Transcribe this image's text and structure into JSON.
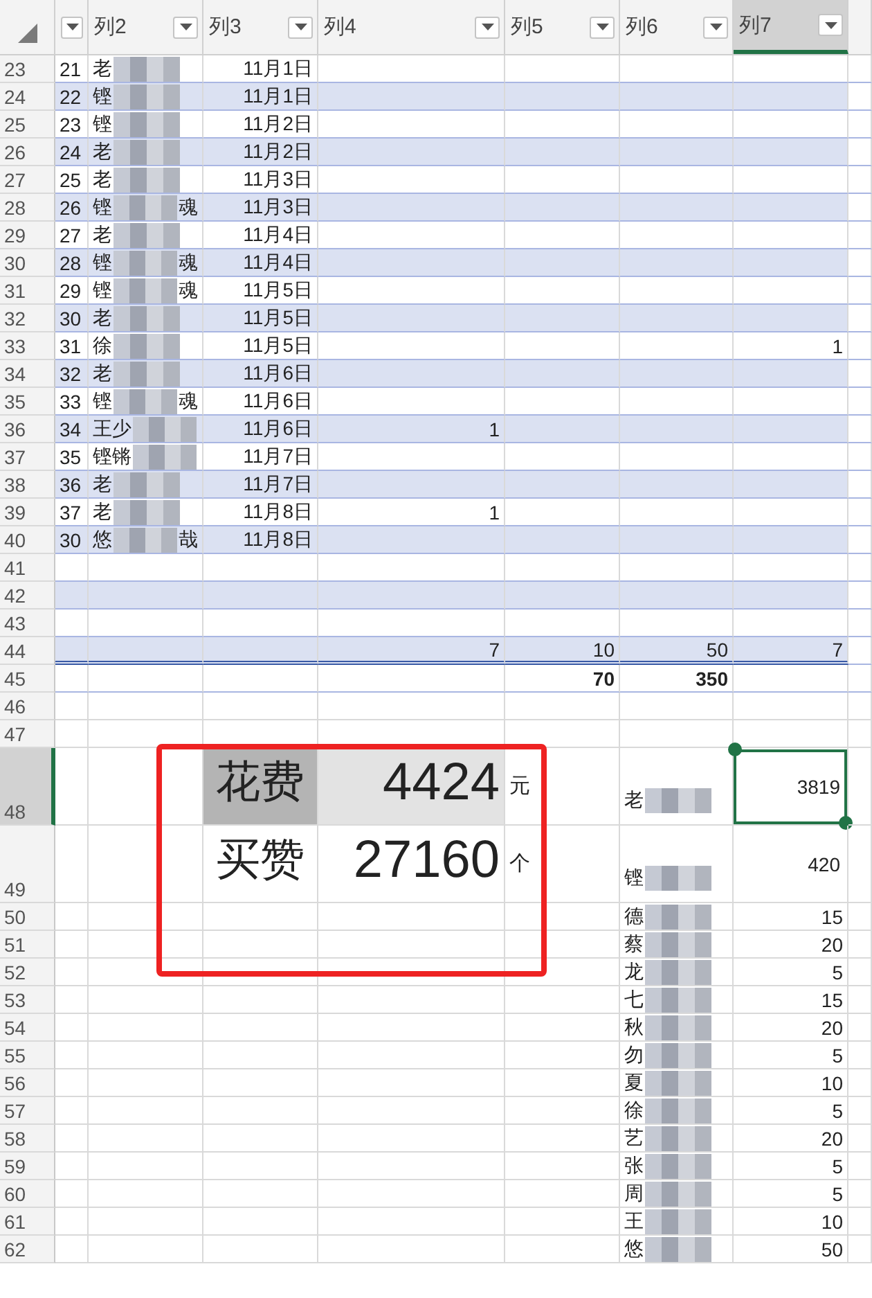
{
  "columns": [
    {
      "selected": false
    },
    {
      "label": "列2",
      "selected": false
    },
    {
      "label": "列3",
      "selected": false
    },
    {
      "label": "列4",
      "selected": false
    },
    {
      "label": "列5",
      "selected": false
    },
    {
      "label": "列6",
      "selected": false
    },
    {
      "label": "列7",
      "selected": true
    }
  ],
  "rows": [
    {
      "number": "23",
      "kind": "plain",
      "selected": false,
      "col_1": "21",
      "col_2": {
        "name": "老"
      },
      "col_3": "11月1日"
    },
    {
      "number": "24",
      "kind": "band",
      "selected": false,
      "col_1": "22",
      "col_2": {
        "name": "铿"
      },
      "col_3": "11月1日"
    },
    {
      "number": "25",
      "kind": "plain",
      "selected": false,
      "col_1": "23",
      "col_2": {
        "name": "铿"
      },
      "col_3": "11月2日"
    },
    {
      "number": "26",
      "kind": "band",
      "selected": false,
      "col_1": "24",
      "col_2": {
        "name": "老"
      },
      "col_3": "11月2日"
    },
    {
      "number": "27",
      "kind": "plain",
      "selected": false,
      "col_1": "25",
      "col_2": {
        "name": "老"
      },
      "col_3": "11月3日"
    },
    {
      "number": "28",
      "kind": "band",
      "selected": false,
      "col_1": "26",
      "col_2": {
        "name": "铿",
        "name_end": "魂"
      },
      "col_3": "11月3日"
    },
    {
      "number": "29",
      "kind": "plain",
      "selected": false,
      "col_1": "27",
      "col_2": {
        "name": "老"
      },
      "col_3": "11月4日"
    },
    {
      "number": "30",
      "kind": "band",
      "selected": false,
      "col_1": "28",
      "col_2": {
        "name": "铿",
        "name_end": "魂"
      },
      "col_3": "11月4日"
    },
    {
      "number": "31",
      "kind": "plain",
      "selected": false,
      "col_1": "29",
      "col_2": {
        "name": "铿",
        "name_end": "魂"
      },
      "col_3": "11月5日"
    },
    {
      "number": "32",
      "kind": "band",
      "selected": false,
      "col_1": "30",
      "col_2": {
        "name": "老"
      },
      "col_3": "11月5日"
    },
    {
      "number": "33",
      "kind": "plain",
      "selected": false,
      "col_1": "31",
      "col_2": {
        "name": "徐"
      },
      "col_3": "11月5日",
      "col_7": "1"
    },
    {
      "number": "34",
      "kind": "band",
      "selected": false,
      "col_1": "32",
      "col_2": {
        "name": "老"
      },
      "col_3": "11月6日"
    },
    {
      "number": "35",
      "kind": "plain",
      "selected": false,
      "col_1": "33",
      "col_2": {
        "name": "铿",
        "name_end": "魂"
      },
      "col_3": "11月6日"
    },
    {
      "number": "36",
      "kind": "band",
      "selected": false,
      "col_1": "34",
      "col_2": {
        "name": "王少"
      },
      "col_3": "11月6日",
      "col_4": "1"
    },
    {
      "number": "37",
      "kind": "plain",
      "selected": false,
      "col_1": "35",
      "col_2": {
        "name": "铿锵"
      },
      "col_3": "11月7日"
    },
    {
      "number": "38",
      "kind": "band",
      "selected": false,
      "col_1": "36",
      "col_2": {
        "name": "老"
      },
      "col_3": "11月7日"
    },
    {
      "number": "39",
      "kind": "plain",
      "selected": false,
      "col_1": "37",
      "col_2": {
        "name": "老"
      },
      "col_3": "11月8日",
      "col_4": "1"
    },
    {
      "number": "40",
      "kind": "band",
      "selected": false,
      "col_1": "30",
      "col_2": {
        "name": "悠",
        "name_end": "哉"
      },
      "col_3": "11月8日"
    },
    {
      "number": "41",
      "kind": "plain",
      "selected": false
    },
    {
      "number": "42",
      "kind": "band",
      "selected": false
    },
    {
      "number": "43",
      "kind": "plain",
      "selected": false
    },
    {
      "number": "44",
      "kind": "total",
      "selected": false,
      "col_4": "7",
      "col_5": "10",
      "col_6": "50",
      "col_7": "7"
    },
    {
      "number": "45",
      "kind": "grand",
      "selected": false,
      "col_5": "70",
      "col_6": "350"
    },
    {
      "number": "46",
      "kind": "grid",
      "selected": false
    },
    {
      "number": "47",
      "kind": "grid",
      "selected": false
    },
    {
      "number": "48",
      "kind": "tall",
      "selected": true,
      "col_3": "花费",
      "label_shaded": true,
      "col_4": "4424",
      "amount_shaded": true,
      "col_5": "元",
      "col_6": {
        "name": "老"
      },
      "col_7": "3819",
      "col_7_selected": true
    },
    {
      "number": "49",
      "kind": "tall",
      "selected": false,
      "col_3": "买赞",
      "label_shaded": false,
      "col_4": "27160",
      "amount_shaded": false,
      "col_5": "个",
      "col_6": {
        "name": "铿"
      },
      "col_7": "420",
      "col_7_selected": false
    },
    {
      "number": "50",
      "kind": "grid",
      "selected": false,
      "col_6": {
        "name": "德"
      },
      "col_7": "15"
    },
    {
      "number": "51",
      "kind": "grid",
      "selected": false,
      "col_6": {
        "name": "蔡"
      },
      "col_7": "20"
    },
    {
      "number": "52",
      "kind": "grid",
      "selected": false,
      "col_6": {
        "name": "龙"
      },
      "col_7": "5"
    },
    {
      "number": "53",
      "kind": "grid",
      "selected": false,
      "col_6": {
        "name": "七"
      },
      "col_7": "15"
    },
    {
      "number": "54",
      "kind": "grid",
      "selected": false,
      "col_6": {
        "name": "秋"
      },
      "col_7": "20"
    },
    {
      "number": "55",
      "kind": "grid",
      "selected": false,
      "col_6": {
        "name": "勿"
      },
      "col_7": "5"
    },
    {
      "number": "56",
      "kind": "grid",
      "selected": false,
      "col_6": {
        "name": "夏"
      },
      "col_7": "10"
    },
    {
      "number": "57",
      "kind": "grid",
      "selected": false,
      "col_6": {
        "name": "徐"
      },
      "col_7": "5"
    },
    {
      "number": "58",
      "kind": "grid",
      "selected": false,
      "col_6": {
        "name": "艺"
      },
      "col_7": "20"
    },
    {
      "number": "59",
      "kind": "grid",
      "selected": false,
      "col_6": {
        "name": "张"
      },
      "col_7": "5"
    },
    {
      "number": "60",
      "kind": "grid",
      "selected": false,
      "col_6": {
        "name": "周"
      },
      "col_7": "5"
    },
    {
      "number": "61",
      "kind": "grid",
      "selected": false,
      "col_6": {
        "name": "王"
      },
      "col_7": "10"
    },
    {
      "number": "62",
      "kind": "grid",
      "selected": false,
      "col_6": {
        "name": "悠"
      },
      "col_7": "50"
    }
  ]
}
